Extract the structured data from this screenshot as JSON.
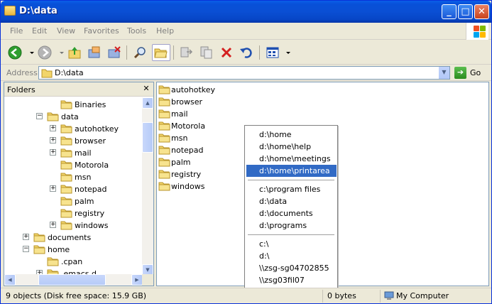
{
  "window": {
    "title": "D:\\data"
  },
  "titlebar_buttons": {
    "minimize": "_",
    "maximize": "□",
    "close": "✕"
  },
  "menu": [
    "File",
    "Edit",
    "View",
    "Favorites",
    "Tools",
    "Help"
  ],
  "toolbar": {
    "tools": [
      "back-icon",
      "back-dropdown-icon",
      "forward-icon",
      "forward-dropdown-icon",
      "up-folder-icon",
      "copy-to-folder-icon",
      "delete-folder-icon",
      "search-icon",
      "folders-icon",
      "move-to-icon",
      "copy-to-icon",
      "delete-icon",
      "undo-icon",
      "views-icon",
      "views-dropdown-icon"
    ]
  },
  "address": {
    "label": "Address",
    "value": "D:\\data",
    "go": "Go"
  },
  "folders": {
    "title": "Folders",
    "close": "✕",
    "tree": [
      {
        "label": "Binaries",
        "indent": 2,
        "expander": ""
      },
      {
        "label": "data",
        "indent": 1,
        "expander": "−"
      },
      {
        "label": "autohotkey",
        "indent": 2,
        "expander": "+"
      },
      {
        "label": "browser",
        "indent": 2,
        "expander": "+"
      },
      {
        "label": "mail",
        "indent": 2,
        "expander": "+"
      },
      {
        "label": "Motorola",
        "indent": 2,
        "expander": ""
      },
      {
        "label": "msn",
        "indent": 2,
        "expander": ""
      },
      {
        "label": "notepad",
        "indent": 2,
        "expander": "+"
      },
      {
        "label": "palm",
        "indent": 2,
        "expander": ""
      },
      {
        "label": "registry",
        "indent": 2,
        "expander": ""
      },
      {
        "label": "windows",
        "indent": 2,
        "expander": "+"
      },
      {
        "label": "documents",
        "indent": 0,
        "expander": "+"
      },
      {
        "label": "home",
        "indent": 0,
        "expander": "−"
      },
      {
        "label": ".cpan",
        "indent": 1,
        "expander": ""
      },
      {
        "label": ".emacs.d",
        "indent": 1,
        "expander": "+"
      }
    ]
  },
  "files": [
    "autohotkey",
    "browser",
    "mail",
    "Motorola",
    "msn",
    "notepad",
    "palm",
    "registry",
    "windows"
  ],
  "popup": {
    "groups": [
      [
        "d:\\home",
        "d:\\home\\help",
        "d:\\home\\meetings",
        "d:\\home\\printarea"
      ],
      [
        "c:\\program files",
        "d:\\data",
        "d:\\documents",
        "d:\\programs"
      ],
      [
        "c:\\",
        "d:\\",
        "\\\\zsg-sg04702855",
        "\\\\zsg03fil07"
      ]
    ],
    "selected": "d:\\home\\printarea"
  },
  "status": {
    "objects": "9 objects (Disk free space: 15.9 GB)",
    "size": "0 bytes",
    "location": "My Computer"
  }
}
